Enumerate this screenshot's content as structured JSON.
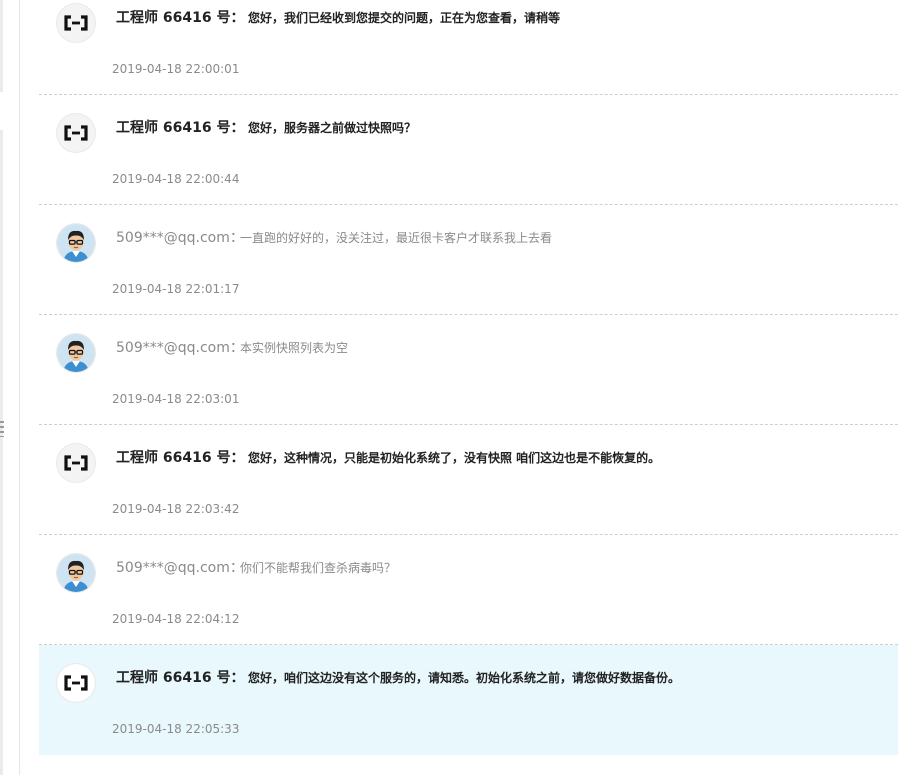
{
  "messages": [
    {
      "role": "engineer",
      "sender": "工程师 66416 号：",
      "content": "您好，我们已经收到您提交的问题，正在为您查看，请稍等",
      "time": "2019-04-18 22:00:01"
    },
    {
      "role": "engineer",
      "sender": "工程师 66416 号：",
      "content": "您好，服务器之前做过快照吗？",
      "time": "2019-04-18 22:00:44"
    },
    {
      "role": "user",
      "sender": "509***@qq.com：",
      "content": "一直跑的好好的，没关注过，最近很卡客户才联系我上去看",
      "time": "2019-04-18 22:01:17"
    },
    {
      "role": "user",
      "sender": "509***@qq.com：",
      "content": "本实例快照列表为空",
      "time": "2019-04-18 22:03:01"
    },
    {
      "role": "engineer",
      "sender": "工程师 66416 号：",
      "content": "您好，这种情况，只能是初始化系统了，没有快照 咱们这边也是不能恢复的。",
      "time": "2019-04-18 22:03:42"
    },
    {
      "role": "user",
      "sender": "509***@qq.com：",
      "content": "你们不能帮我们查杀病毒吗？",
      "time": "2019-04-18 22:04:12"
    },
    {
      "role": "engineer",
      "sender": "工程师 66416 号：",
      "content": "您好，咱们这边没有这个服务的，请知悉。初始化系统之前，请您做好数据备份。",
      "time": "2019-04-18 22:05:33"
    }
  ],
  "icons": {
    "engineer_avatar": "aliyun-logo-icon",
    "user_avatar": "user-avatar-icon"
  },
  "colors": {
    "highlight_bg": "#e8f8fd",
    "divider": "#cfcfcf",
    "muted_text": "#8a8a8a"
  }
}
